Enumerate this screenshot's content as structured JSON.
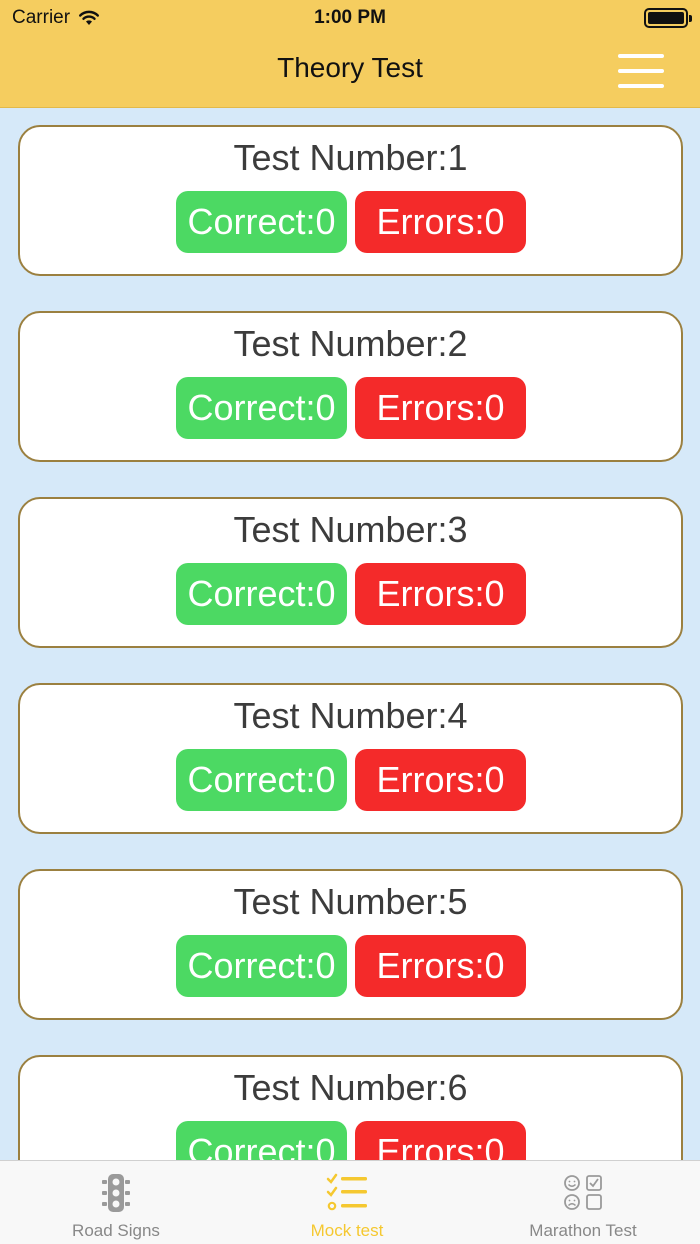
{
  "status_bar": {
    "carrier": "Carrier",
    "time": "1:00 PM"
  },
  "header": {
    "title": "Theory Test",
    "menu_icon": "hamburger-menu-icon"
  },
  "tests": [
    {
      "title": "Test Number:1",
      "correct": "Correct:0",
      "errors": "Errors:0"
    },
    {
      "title": "Test Number:2",
      "correct": "Correct:0",
      "errors": "Errors:0"
    },
    {
      "title": "Test Number:3",
      "correct": "Correct:0",
      "errors": "Errors:0"
    },
    {
      "title": "Test Number:4",
      "correct": "Correct:0",
      "errors": "Errors:0"
    },
    {
      "title": "Test Number:5",
      "correct": "Correct:0",
      "errors": "Errors:0"
    },
    {
      "title": "Test Number:6",
      "correct": "Correct:0",
      "errors": "Errors:0"
    }
  ],
  "tabbar": {
    "tabs": [
      {
        "label": "Road Signs",
        "icon": "traffic-light-icon",
        "active": false
      },
      {
        "label": "Mock test",
        "icon": "checklist-icon",
        "active": true
      },
      {
        "label": "Marathon Test",
        "icon": "smiley-checkbox-icon",
        "active": false
      }
    ]
  },
  "colors": {
    "header": "#f5cd5f",
    "background": "#d6e9f9",
    "correct": "#4cd963",
    "errors": "#f42a2a",
    "active_tab": "#f5c830",
    "inactive_tab": "#888888"
  }
}
